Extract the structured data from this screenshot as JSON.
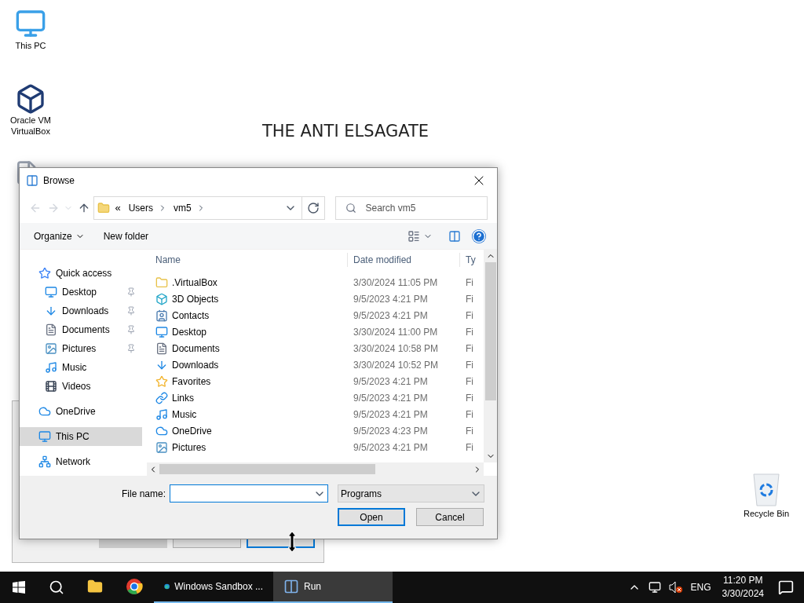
{
  "desktop": {
    "icons": [
      {
        "label": "This PC"
      },
      {
        "label": "Oracle VM VirtualBox"
      }
    ],
    "recycle_bin": {
      "label": "Recycle Bin"
    },
    "wallpaper": [
      "THE ANTI ELSAGATE"
    ]
  },
  "run_dialog": {
    "buttons": [
      {
        "disabled": true
      },
      {
        "disabled": false
      },
      {
        "disabled": false
      }
    ]
  },
  "browse_dialog": {
    "title": "Browse",
    "address": {
      "overflow": "«",
      "crumbs": [
        "Users",
        "vm5"
      ]
    },
    "search": {
      "placeholder": "Search vm5"
    },
    "toolbar": {
      "organize": "Organize",
      "new_folder": "New folder"
    },
    "nav_pane": [
      {
        "label": "Quick access",
        "selected": false,
        "children": [
          {
            "label": "Desktop",
            "pinned": true,
            "selected": false
          },
          {
            "label": "Downloads",
            "pinned": true,
            "selected": false
          },
          {
            "label": "Documents",
            "pinned": true,
            "selected": false
          },
          {
            "label": "Pictures",
            "pinned": true,
            "selected": false
          },
          {
            "label": "Music",
            "pinned": false,
            "selected": false
          },
          {
            "label": "Videos",
            "pinned": false,
            "selected": false
          }
        ]
      },
      {
        "label": "OneDrive",
        "selected": false
      },
      {
        "label": "This PC",
        "selected": true
      },
      {
        "label": "Network",
        "selected": false
      }
    ],
    "columns": [
      "Name",
      "Date modified",
      "Ty"
    ],
    "rows": [
      {
        "name": ".VirtualBox",
        "date": "3/30/2024 11:05 PM",
        "type": "Fi",
        "selected": false
      },
      {
        "name": "3D Objects",
        "date": "9/5/2023 4:21 PM",
        "type": "Fi",
        "selected": false
      },
      {
        "name": "Contacts",
        "date": "9/5/2023 4:21 PM",
        "type": "Fi",
        "selected": false
      },
      {
        "name": "Desktop",
        "date": "3/30/2024 11:00 PM",
        "type": "Fi",
        "selected": false
      },
      {
        "name": "Documents",
        "date": "3/30/2024 10:58 PM",
        "type": "Fi",
        "selected": false
      },
      {
        "name": "Downloads",
        "date": "3/30/2024 10:52 PM",
        "type": "Fi",
        "selected": false
      },
      {
        "name": "Favorites",
        "date": "9/5/2023 4:21 PM",
        "type": "Fi",
        "selected": false
      },
      {
        "name": "Links",
        "date": "9/5/2023 4:21 PM",
        "type": "Fi",
        "selected": false
      },
      {
        "name": "Music",
        "date": "9/5/2023 4:21 PM",
        "type": "Fi",
        "selected": false
      },
      {
        "name": "OneDrive",
        "date": "9/5/2023 4:23 PM",
        "type": "Fi",
        "selected": false
      },
      {
        "name": "Pictures",
        "date": "9/5/2023 4:21 PM",
        "type": "Fi",
        "selected": false
      }
    ],
    "file_name": {
      "label": "File name:"
    },
    "filter": {
      "value": "Programs"
    },
    "buttons": [
      {
        "label": "Open",
        "default": true
      },
      {
        "label": "Cancel",
        "default": false
      }
    ]
  },
  "taskbar": {
    "apps": [
      {
        "running": false,
        "selected": false
      },
      {
        "running": false,
        "selected": false
      },
      {
        "label": "Windows Sandbox ...",
        "running": true,
        "selected": false
      },
      {
        "label": "Run",
        "running": true,
        "selected": true
      }
    ],
    "language": "ENG",
    "time": "11:20 PM",
    "date": "3/30/2024"
  }
}
